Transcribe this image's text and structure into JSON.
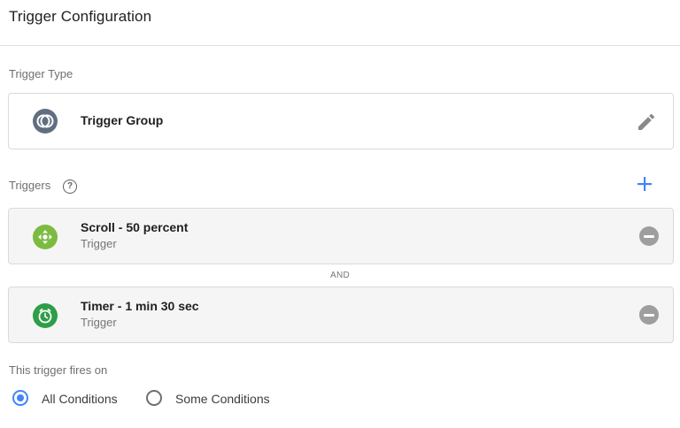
{
  "header": {
    "title": "Trigger Configuration"
  },
  "trigger_type": {
    "label": "Trigger Type",
    "name": "Trigger Group",
    "icon": "trigger-group-icon",
    "icon_color": "#5f6f80"
  },
  "triggers": {
    "label": "Triggers",
    "help_glyph": "?",
    "items": [
      {
        "title": "Scroll - 50 percent",
        "subtitle": "Trigger",
        "icon": "scroll-icon",
        "icon_color": "#7cbb3f"
      },
      {
        "title": "Timer - 1 min 30 sec",
        "subtitle": "Trigger",
        "icon": "timer-icon",
        "icon_color": "#2e9e48"
      }
    ],
    "joiner": "AND"
  },
  "fires_on": {
    "label": "This trigger fires on",
    "options": [
      {
        "label": "All Conditions",
        "selected": true
      },
      {
        "label": "Some Conditions",
        "selected": false
      }
    ]
  },
  "colors": {
    "accent": "#4285f4",
    "remove": "#9e9e9e"
  }
}
